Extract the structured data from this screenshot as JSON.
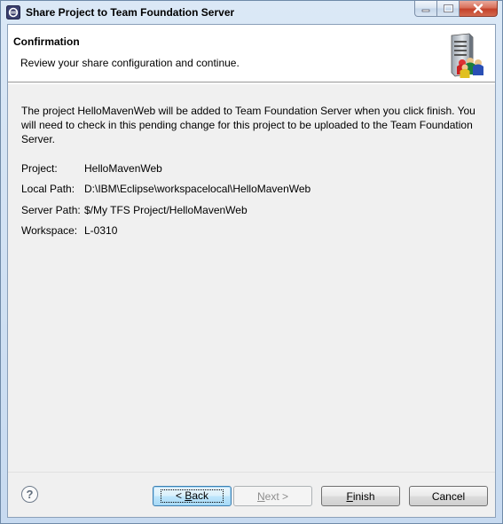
{
  "window": {
    "title": "Share Project to Team Foundation Server"
  },
  "banner": {
    "title": "Confirmation",
    "subtitle": "Review your share configuration and continue."
  },
  "message": "The project HelloMavenWeb will be added to Team Foundation Server when you click finish.  You will need to check in this pending change for this project to be uploaded to the Team Foundation Server.",
  "details": [
    {
      "label": "Project:",
      "value": "HelloMavenWeb"
    },
    {
      "label": "Local Path:",
      "value": "D:\\IBM\\Eclipse\\workspacelocal\\HelloMavenWeb"
    },
    {
      "label": "Server Path:",
      "value": "$/My TFS Project/HelloMavenWeb"
    },
    {
      "label": "Workspace:",
      "value": "L-0310"
    }
  ],
  "buttons": {
    "help": "?",
    "back_pre": "< ",
    "back_mn": "B",
    "back_post": "ack",
    "next_mn": "N",
    "next_post": "ext >",
    "finish_mn": "F",
    "finish_post": "inish",
    "cancel": "Cancel"
  },
  "icons": {
    "title": "eclipse-icon",
    "banner": "server-users-icon"
  }
}
